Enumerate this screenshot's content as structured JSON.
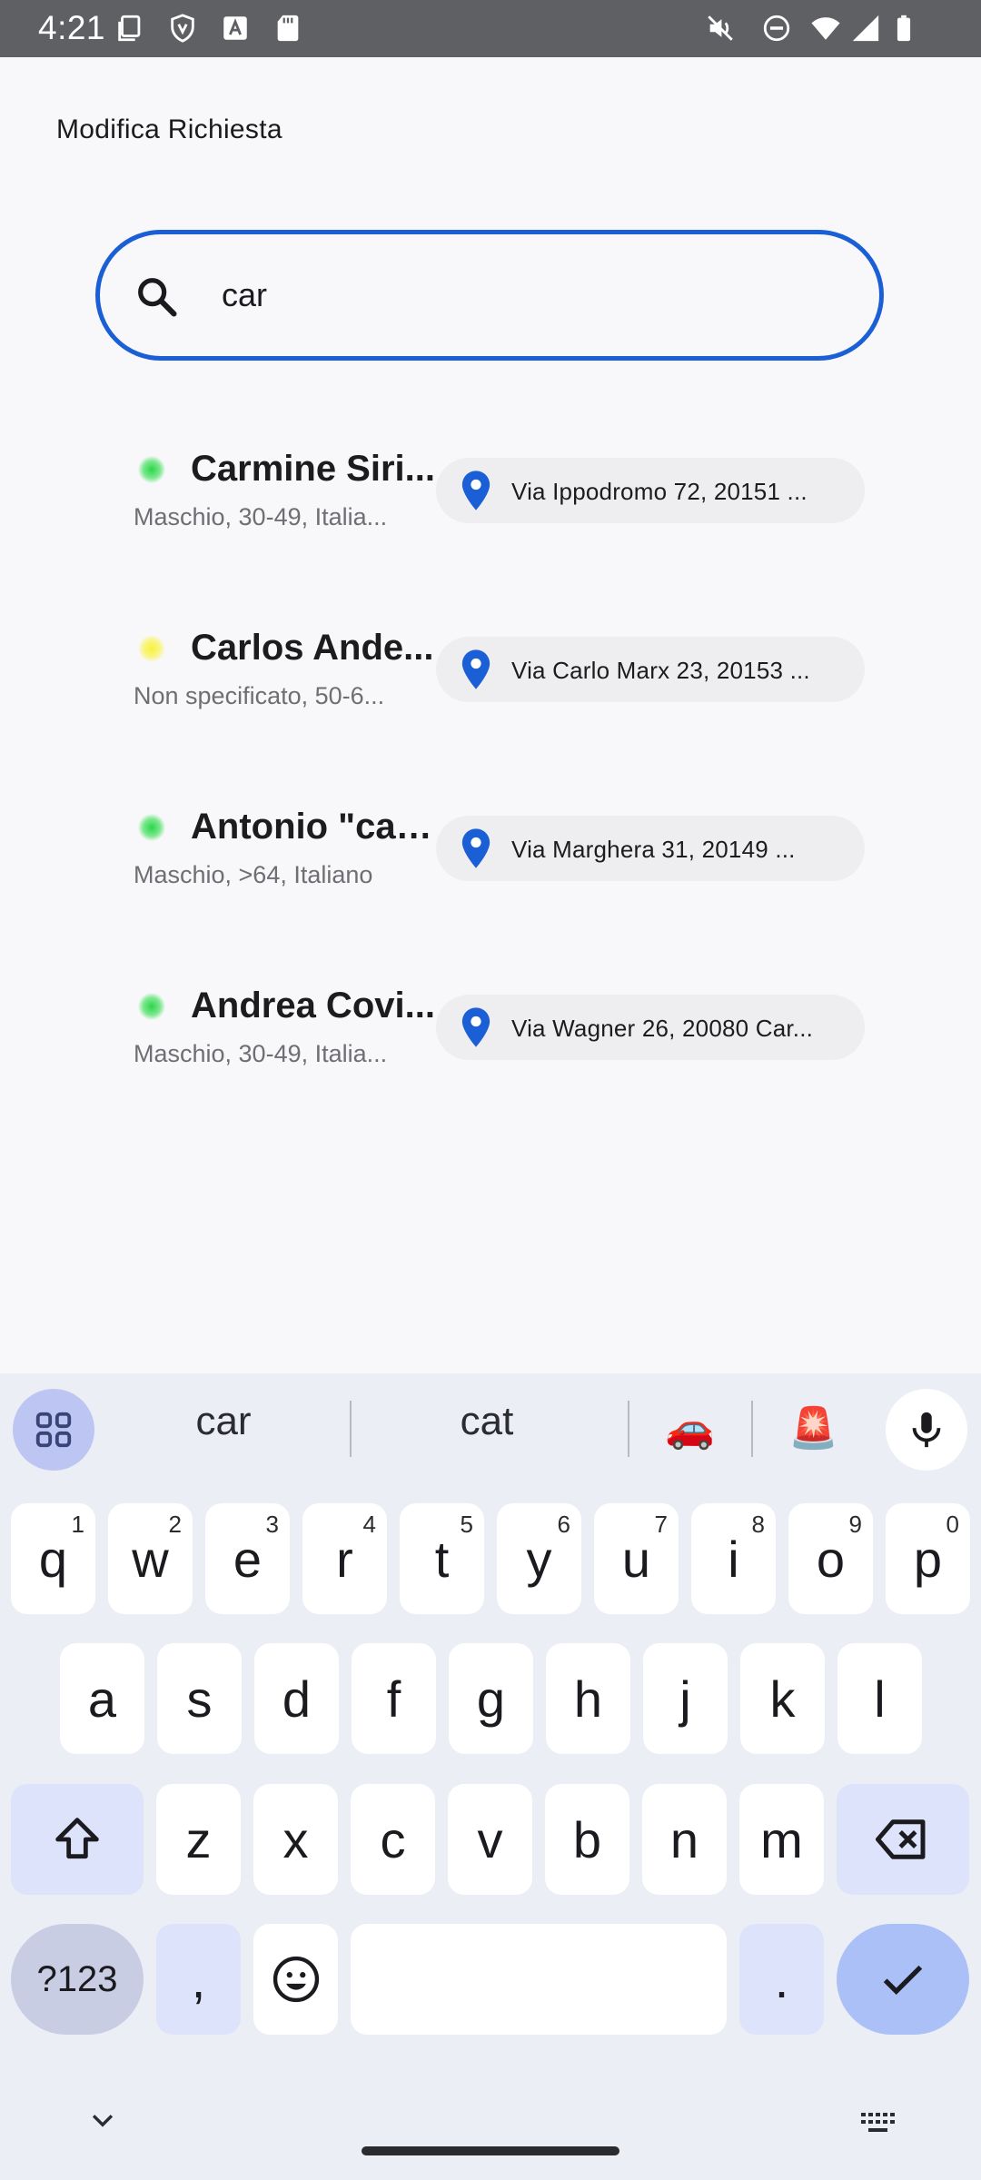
{
  "status_bar": {
    "time": "4:21",
    "icons": [
      "screenshot-icon",
      "vpn-shield-icon",
      "accessibility-a-icon",
      "sd-card-icon",
      "mute-icon",
      "dnd-icon",
      "wifi-icon",
      "signal-icon",
      "battery-icon"
    ]
  },
  "header": {
    "title": "Modifica Richiesta"
  },
  "search": {
    "value": "car",
    "placeholder": ""
  },
  "results": [
    {
      "name": "Carmine Siri...",
      "meta": "Maschio, 30-49,  Italia...",
      "status": "green",
      "address": "Via Ippodromo 72, 20151 ..."
    },
    {
      "name": "Carlos Ande...",
      "meta": "Non specificato, 50-6...",
      "status": "yellow",
      "address": "Via Carlo Marx 23, 20153 ..."
    },
    {
      "name": "Antonio \"car...",
      "meta": "Maschio, >64,  Italiano",
      "status": "green",
      "address": "Via Marghera 31, 20149 ..."
    },
    {
      "name": "Andrea Covi...",
      "meta": "Maschio, 30-49,  Italia...",
      "status": "green",
      "address": "Via Wagner 26, 20080 Car..."
    }
  ],
  "keyboard": {
    "suggestions": [
      "car",
      "cat"
    ],
    "emoji_suggestions": [
      "🚗",
      "🚨"
    ],
    "row1": [
      {
        "k": "q",
        "n": "1"
      },
      {
        "k": "w",
        "n": "2"
      },
      {
        "k": "e",
        "n": "3"
      },
      {
        "k": "r",
        "n": "4"
      },
      {
        "k": "t",
        "n": "5"
      },
      {
        "k": "y",
        "n": "6"
      },
      {
        "k": "u",
        "n": "7"
      },
      {
        "k": "i",
        "n": "8"
      },
      {
        "k": "o",
        "n": "9"
      },
      {
        "k": "p",
        "n": "0"
      }
    ],
    "row2": [
      "a",
      "s",
      "d",
      "f",
      "g",
      "h",
      "j",
      "k",
      "l"
    ],
    "row3": [
      "z",
      "x",
      "c",
      "v",
      "b",
      "n",
      "m"
    ],
    "symbols_label": "?123",
    "comma": ",",
    "period": "."
  },
  "colors": {
    "accent": "#1a5fd6",
    "status_green": "#2bd64a",
    "status_yellow": "#f7f23a",
    "pin": "#1a5fd6"
  }
}
